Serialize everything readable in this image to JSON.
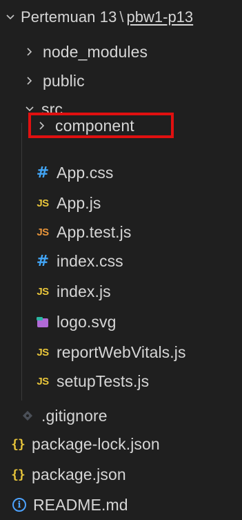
{
  "explorer": {
    "header": {
      "folder": "Pertemuan 13",
      "separator": "\\",
      "subfolder": "pbw1-p13"
    },
    "items": [
      {
        "label": "node_modules",
        "kind": "folder",
        "expanded": false
      },
      {
        "label": "public",
        "kind": "folder",
        "expanded": false
      },
      {
        "label": "src",
        "kind": "folder",
        "expanded": true
      },
      {
        "label": "component",
        "kind": "folder",
        "expanded": false,
        "highlighted": true
      },
      {
        "label": "App.css",
        "kind": "css",
        "icon": "#"
      },
      {
        "label": "App.js",
        "kind": "js",
        "icon": "JS"
      },
      {
        "label": "App.test.js",
        "kind": "js-test",
        "icon": "JS"
      },
      {
        "label": "index.css",
        "kind": "css",
        "icon": "#"
      },
      {
        "label": "index.js",
        "kind": "js",
        "icon": "JS"
      },
      {
        "label": "logo.svg",
        "kind": "svg"
      },
      {
        "label": "reportWebVitals.js",
        "kind": "js",
        "icon": "JS"
      },
      {
        "label": "setupTests.js",
        "kind": "js",
        "icon": "JS"
      },
      {
        "label": ".gitignore",
        "kind": "git"
      },
      {
        "label": "package-lock.json",
        "kind": "json",
        "icon": "{}"
      },
      {
        "label": "package.json",
        "kind": "json",
        "icon": "{}"
      },
      {
        "label": "README.md",
        "kind": "info",
        "icon": "i"
      }
    ]
  },
  "colors": {
    "background": "#1f1f1f",
    "js": "#e8c53a",
    "js_test": "#e8943a",
    "css": "#42a5f5",
    "json": "#e8c53a",
    "info": "#4da3ff",
    "svg": "#b06ad6",
    "highlight": "#e01010"
  }
}
